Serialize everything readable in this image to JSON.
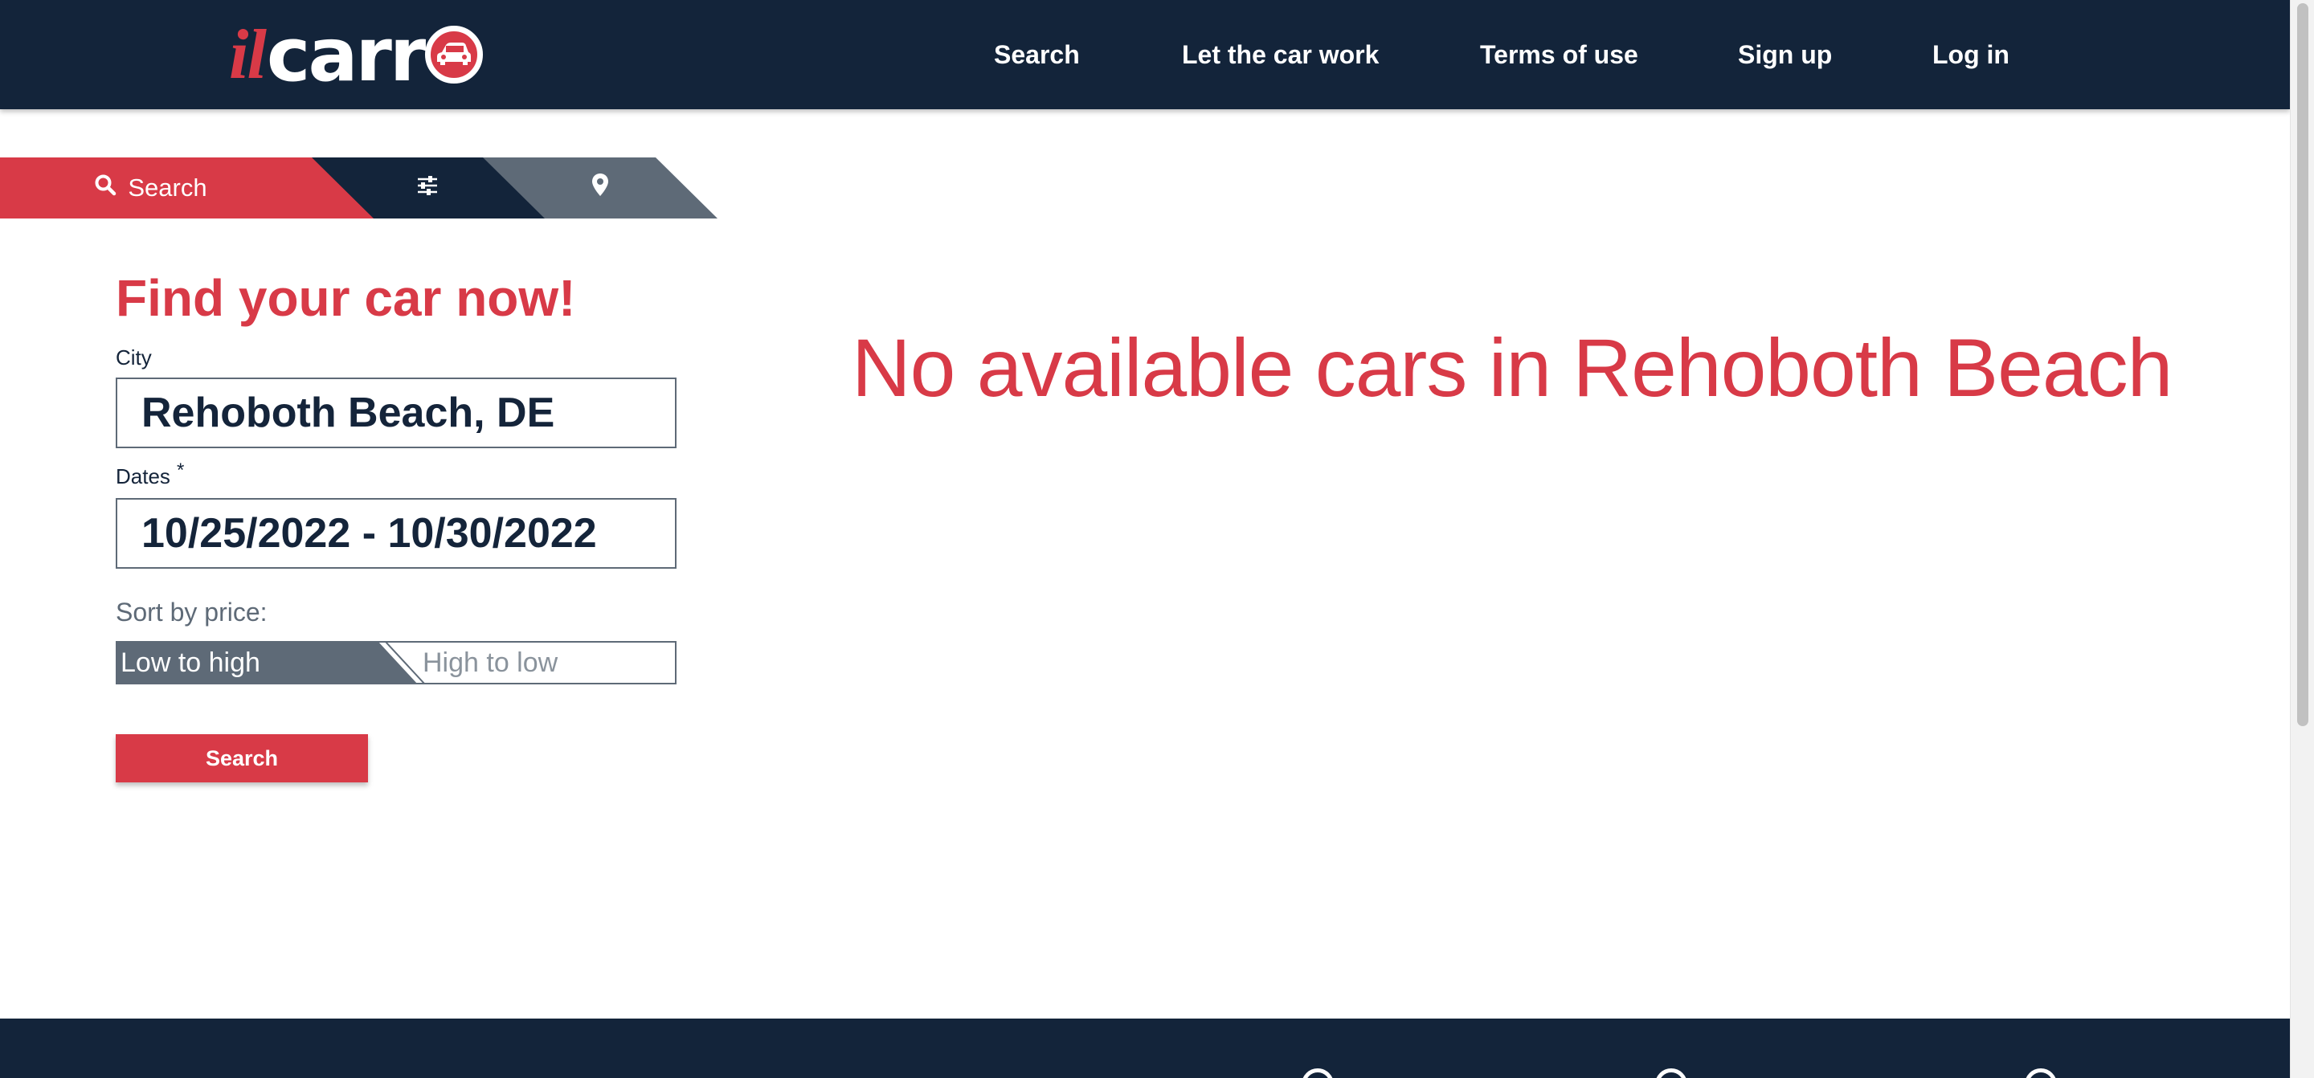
{
  "header": {
    "logo": {
      "prefix": "il",
      "main": "carr"
    },
    "nav": [
      {
        "label": "Search"
      },
      {
        "label": "Let the car work"
      },
      {
        "label": "Terms of use"
      },
      {
        "label": "Sign up"
      },
      {
        "label": "Log in"
      }
    ]
  },
  "tabs": {
    "search_label": "Search",
    "filter_icon": "sliders-icon",
    "map_icon": "map-pin-icon"
  },
  "form": {
    "title": "Find your car now!",
    "city_label": "City",
    "city_value": "Rehoboth Beach, DE",
    "dates_label": "Dates",
    "dates_required_mark": "*",
    "dates_value": "10/25/2022 - 10/30/2022",
    "sort_label": "Sort by price:",
    "sort_low": "Low to high",
    "sort_high": "High to low",
    "sort_selected": "Low to high",
    "search_button": "Search"
  },
  "results": {
    "message": "No available cars in Rehoboth Beach"
  },
  "colors": {
    "brand_red": "#d83a47",
    "navy": "#13243a",
    "slate": "#5e6a77"
  }
}
